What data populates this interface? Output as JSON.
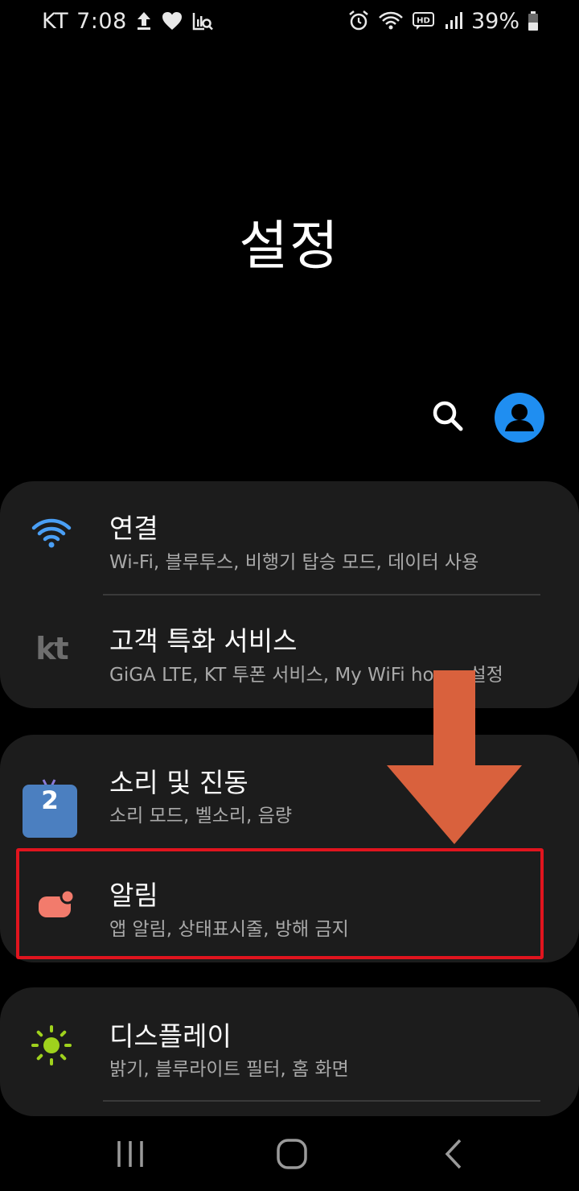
{
  "status_bar": {
    "carrier": "KT",
    "time": "7:08",
    "battery": "39%",
    "left_icons": [
      "upload-icon",
      "heart-icon",
      "image-search-icon"
    ],
    "right_icons": [
      "alarm-icon",
      "wifi-icon",
      "hd-voice-icon",
      "signal-icon",
      "battery-icon"
    ]
  },
  "header": {
    "title": "설정",
    "actions": [
      "search-icon",
      "profile-icon"
    ]
  },
  "settings_groups": [
    {
      "items": [
        {
          "title": "연결",
          "subtitle": "Wi-Fi, 블루투스, 비행기 탑승 모드, 데이터 사용",
          "icon": "wifi-icon",
          "icon_color": "#4a9ff5"
        },
        {
          "title": "고객 특화 서비스",
          "subtitle": "GiGA LTE, KT 투폰 서비스, My WiFi home 설정",
          "icon": "kt-logo-icon",
          "icon_color": "#6e6e6e",
          "icon_text": "kt"
        }
      ]
    },
    {
      "items": [
        {
          "title": "소리 및 진동",
          "subtitle": "소리 모드, 벨소리, 음량",
          "icon": "calendar-icon",
          "icon_color": "#4b7fc0",
          "icon_text": "2"
        },
        {
          "title": "알림",
          "subtitle": "앱 알림, 상태표시줄, 방해 금지",
          "icon": "notification-icon",
          "icon_color": "#f27b6c",
          "highlighted": true
        }
      ]
    },
    {
      "items": [
        {
          "title": "디스플레이",
          "subtitle": "밝기, 블루라이트 필터, 홈 화면",
          "icon": "brightness-icon",
          "icon_color": "#9fd21d"
        }
      ]
    }
  ],
  "annotation": {
    "arrow_color": "#d9613d",
    "highlight_color": "#e0141e"
  },
  "nav_bar": {
    "buttons": [
      "recent-apps-icon",
      "home-icon",
      "back-icon"
    ]
  }
}
